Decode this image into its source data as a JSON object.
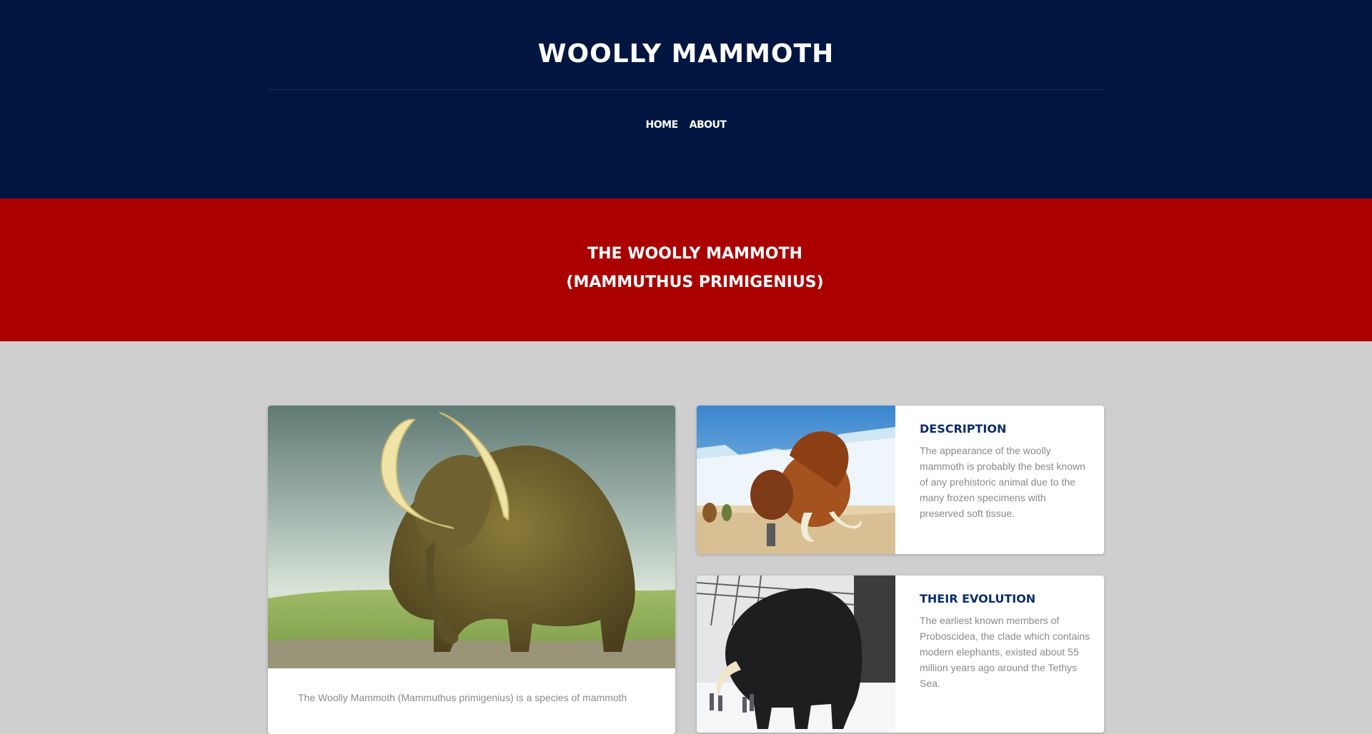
{
  "header": {
    "site_title": "WOOLLY MAMMOTH",
    "nav": [
      {
        "label": "HOME"
      },
      {
        "label": "ABOUT"
      }
    ],
    "background": "#001641"
  },
  "banner": {
    "line1": "THE WOOLLY MAMMOTH",
    "line2": "(MAMMUTHUS PRIMIGENIUS)",
    "background": "#ab0000"
  },
  "main_card": {
    "image": "woolly-mammoth-illustration",
    "text": "The Woolly Mammoth (Mammuthus primigenius) is a species of mammoth"
  },
  "cards": [
    {
      "image": "ice-age-mammoths-cartoon",
      "title": "DESCRIPTION",
      "text": "The appearance of the woolly mammoth is probably the best known of any prehistoric animal due to the many frozen specimens with preserved soft tissue."
    },
    {
      "image": "museum-mammoth-model",
      "title": "THEIR EVOLUTION",
      "text": "The earliest known members of Proboscidea, the clade which contains modern elephants, existed about 55 million years ago around the Tethys Sea."
    }
  ],
  "colors": {
    "page_background": "#cfcfcf",
    "heading_blue": "#0b2d6a",
    "body_text_grey": "#8a8a8a"
  }
}
